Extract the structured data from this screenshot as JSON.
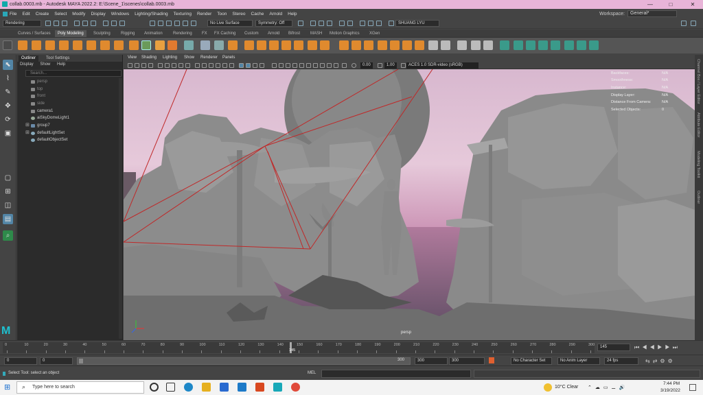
{
  "window": {
    "title": "collab.0003.mb - Autodesk MAYA 2022.2: E:\\Scene_1\\scenes\\collab.0003.mb",
    "minimize": "—",
    "maximize": "□",
    "close": "✕"
  },
  "menubar": {
    "items": [
      "File",
      "Edit",
      "Create",
      "Select",
      "Modify",
      "Display",
      "Windows",
      "Lighting/Shading",
      "Texturing",
      "Render",
      "Toon",
      "Stereo",
      "Cache",
      "Arnold",
      "Help"
    ],
    "workspace_label": "Workspace:",
    "workspace_value": "General*"
  },
  "statusline": {
    "menuset": "Rendering",
    "live_surface": "No Live Surface",
    "symmetry": "Symmetry: Off",
    "user": "SHUANG LYU"
  },
  "shelf": {
    "tabs": [
      "Curves / Surfaces",
      "Poly Modeling",
      "Sculpting",
      "Rigging",
      "Animation",
      "Rendering",
      "FX",
      "FX Caching",
      "Custom",
      "Arnold",
      "Bifrost",
      "MASH",
      "Motion Graphics",
      "XGen"
    ],
    "active_tab": "Poly Modeling"
  },
  "outliner": {
    "tabs": [
      "Outliner",
      "Tool Settings"
    ],
    "menu": [
      "Display",
      "Show",
      "Help"
    ],
    "search_placeholder": "Search...",
    "items": [
      {
        "label": "persp",
        "dim": true,
        "expandable": false
      },
      {
        "label": "top",
        "dim": true,
        "expandable": false
      },
      {
        "label": "front",
        "dim": true,
        "expandable": false
      },
      {
        "label": "side",
        "dim": true,
        "expandable": false
      },
      {
        "label": "camera1",
        "dim": false,
        "expandable": false
      },
      {
        "label": "aiSkyDomeLight1",
        "dim": false,
        "expandable": false
      },
      {
        "label": "group7",
        "dim": false,
        "expandable": true
      },
      {
        "label": "defaultLightSet",
        "dim": false,
        "expandable": true
      },
      {
        "label": "defaultObjectSet",
        "dim": false,
        "expandable": false
      }
    ]
  },
  "viewport": {
    "menu": [
      "View",
      "Shading",
      "Lighting",
      "Show",
      "Renderer",
      "Panels"
    ],
    "exposure": "0.00",
    "gamma": "1.00",
    "colorspace": "ACES 1.0 SDR-video (sRGB)",
    "camera_label": "persp",
    "hud": [
      {
        "label": "Backfaces:",
        "value": "N/A"
      },
      {
        "label": "Smoothness:",
        "value": "N/A"
      },
      {
        "label": "Instance:",
        "value": "N/A"
      },
      {
        "label": "Display Layer:",
        "value": "N/A"
      },
      {
        "label": "Distance From Camera:",
        "value": "N/A"
      },
      {
        "label": "Selected Objects:",
        "value": "0"
      }
    ]
  },
  "right_tabs": [
    "Channel Box / Layer Editor",
    "Attribute Editor",
    "Modeling Toolkit",
    "Outliner"
  ],
  "timeline": {
    "ticks": [
      "0",
      "10",
      "20",
      "30",
      "40",
      "50",
      "60",
      "70",
      "80",
      "90",
      "100",
      "110",
      "120",
      "130",
      "140",
      "150",
      "160",
      "170",
      "180",
      "190",
      "200",
      "210",
      "220",
      "230",
      "240",
      "250",
      "260",
      "270",
      "280",
      "290",
      "300"
    ],
    "current_frame": "145",
    "current_frame_field": "145"
  },
  "range": {
    "start": "0",
    "playback_start": "0",
    "playback_end": "300",
    "end": "300",
    "end2": "300",
    "character_set": "No Character Set",
    "anim_layer": "No Anim Layer",
    "fps": "24 fps"
  },
  "helpline": {
    "text": "Select Tool: select an object",
    "mel_label": "MEL"
  },
  "taskbar": {
    "search_placeholder": "Type here to search",
    "weather": "10°C  Clear",
    "time": "7:44 PM",
    "date": "3/19/2022"
  }
}
